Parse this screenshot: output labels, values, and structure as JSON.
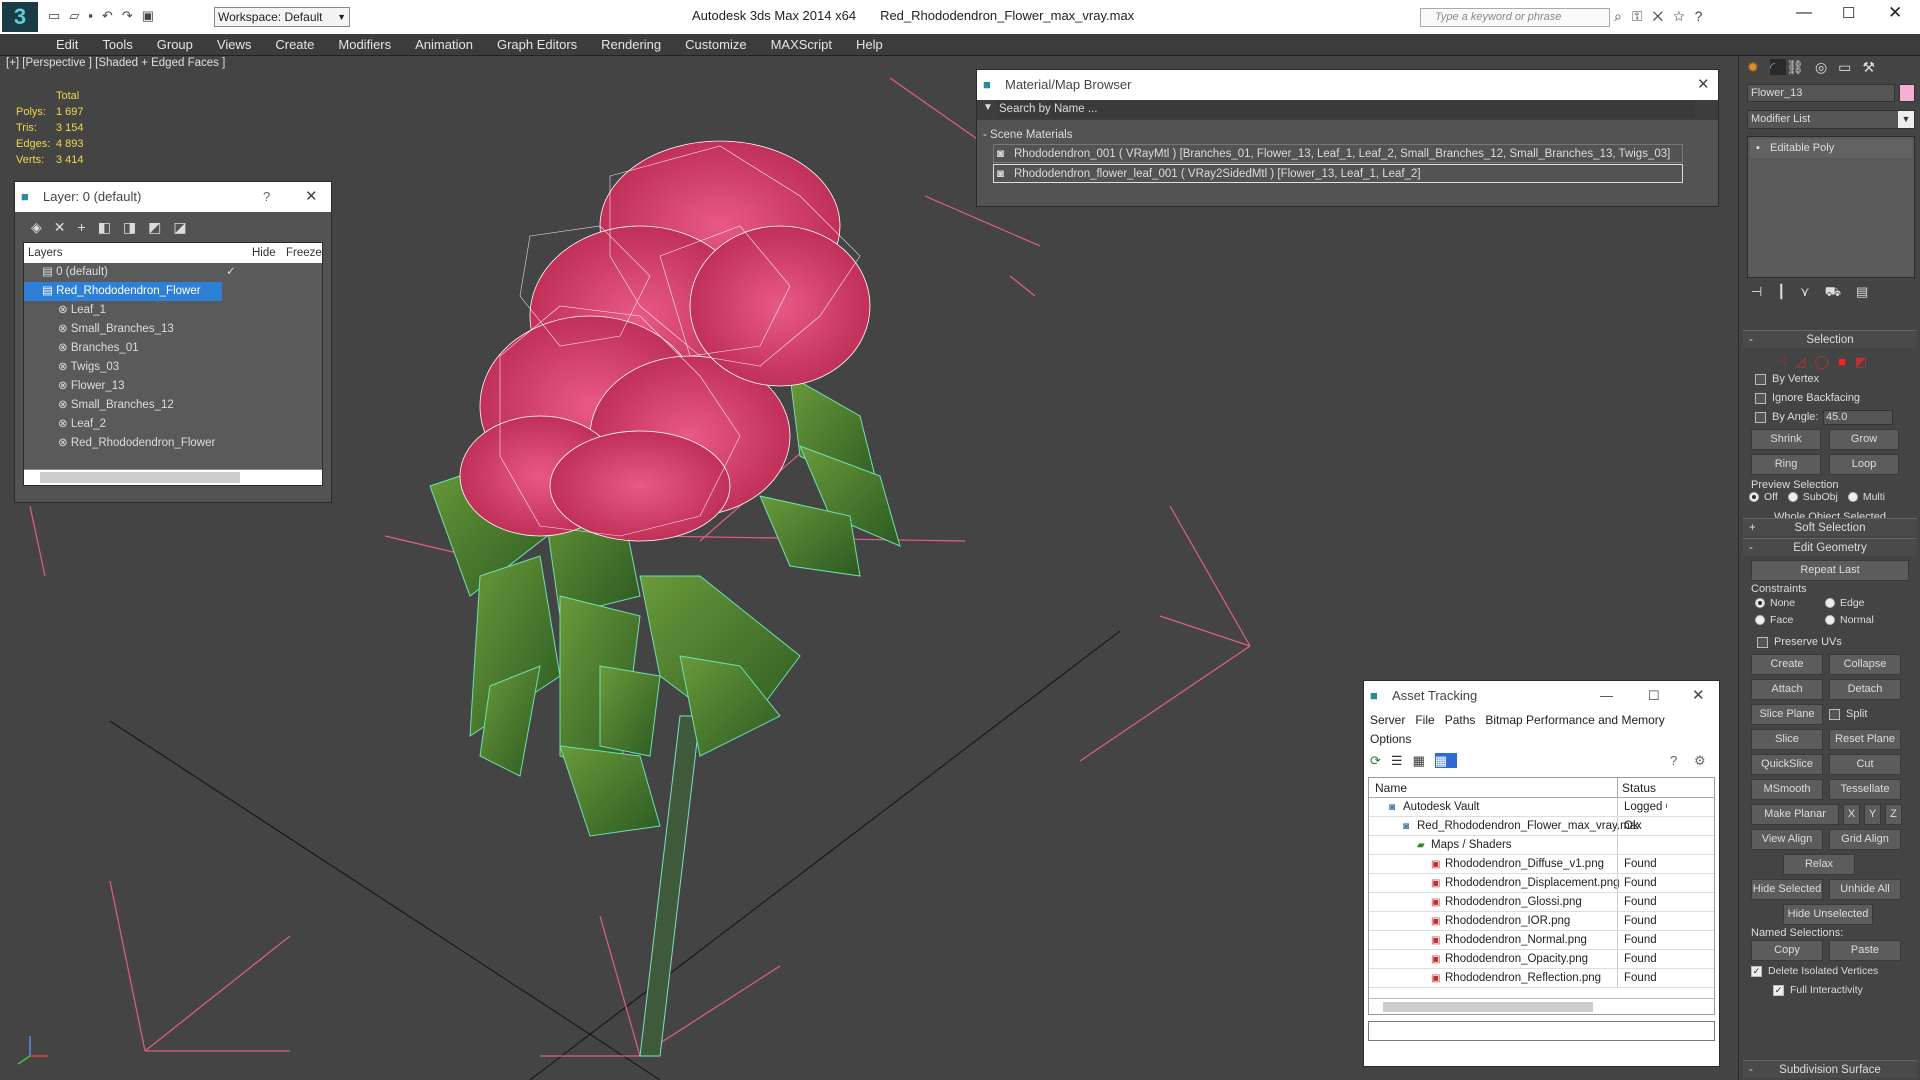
{
  "title": {
    "app": "Autodesk 3ds Max  2014 x64",
    "file": "Red_Rhododendron_Flower_max_vray.max",
    "workspace": "Workspace: Default",
    "search_placeholder": "Type a keyword or phrase"
  },
  "menu": [
    "Edit",
    "Tools",
    "Group",
    "Views",
    "Create",
    "Modifiers",
    "Animation",
    "Graph Editors",
    "Rendering",
    "Customize",
    "MAXScript",
    "Help"
  ],
  "viewport": {
    "label": "[+] [Perspective ] [Shaded + Edged Faces ]",
    "stats": {
      "header": "Total",
      "rows": [
        {
          "k": "Polys:",
          "v": "1 697"
        },
        {
          "k": "Tris:",
          "v": "3 154"
        },
        {
          "k": "Edges:",
          "v": "4 893"
        },
        {
          "k": "Verts:",
          "v": "3 414"
        }
      ]
    }
  },
  "layer": {
    "title": "Layer: 0 (default)",
    "help": "?",
    "cols": {
      "name": "Layers",
      "hide": "Hide",
      "freeze": "Freeze"
    },
    "rows": [
      "0 (default)",
      "Red_Rhododendron_Flower",
      "Leaf_1",
      "Small_Branches_13",
      "Branches_01",
      "Twigs_03",
      "Flower_13",
      "Small_Branches_12",
      "Leaf_2",
      "Red_Rhododendron_Flower"
    ]
  },
  "material": {
    "title": "Material/Map Browser",
    "search": "Search by Name ...",
    "section": "- Scene Materials",
    "items": [
      "Rhododendron_001  ( VRayMtl )  [Branches_01, Flower_13, Leaf_1, Leaf_2, Small_Branches_12, Small_Branches_13, Twigs_03]",
      "Rhododendron_flower_leaf_001  ( VRay2SidedMtl )  [Flower_13, Leaf_1, Leaf_2]"
    ]
  },
  "asset": {
    "title": "Asset Tracking",
    "menu": [
      "Server",
      "File",
      "Paths",
      "Bitmap Performance and Memory"
    ],
    "menu2": "Options",
    "cols": {
      "name": "Name",
      "status": "Status"
    },
    "rows": [
      {
        "n": "Autodesk Vault",
        "s": "Logged C",
        "ind": 0
      },
      {
        "n": "Red_Rhododendron_Flower_max_vray.max",
        "s": "Ok",
        "ind": 1
      },
      {
        "n": "Maps / Shaders",
        "s": "",
        "ind": 2
      },
      {
        "n": "Rhododendron_Diffuse_v1.png",
        "s": "Found",
        "ind": 3
      },
      {
        "n": "Rhododendron_Displacement.png",
        "s": "Found",
        "ind": 3
      },
      {
        "n": "Rhododendron_Glossi.png",
        "s": "Found",
        "ind": 3
      },
      {
        "n": "Rhododendron_IOR.png",
        "s": "Found",
        "ind": 3
      },
      {
        "n": "Rhododendron_Normal.png",
        "s": "Found",
        "ind": 3
      },
      {
        "n": "Rhododendron_Opacity.png",
        "s": "Found",
        "ind": 3
      },
      {
        "n": "Rhododendron_Reflection.png",
        "s": "Found",
        "ind": 3
      }
    ]
  },
  "cmd": {
    "object": "Flower_13",
    "modlist": "Modifier List",
    "stack": "Editable Poly",
    "selection": {
      "title": "Selection",
      "by_vertex": "By Vertex",
      "ignore_backfacing": "Ignore Backfacing",
      "by_angle": "By Angle:",
      "angle": "45.0",
      "shrink": "Shrink",
      "grow": "Grow",
      "ring": "Ring",
      "loop": "Loop",
      "preview": "Preview Selection",
      "off": "Off",
      "subobj": "SubObj",
      "multi": "Multi",
      "status": "Whole Object Selected"
    },
    "soft": "Soft Selection",
    "editgeo": "Edit Geometry",
    "repeat": "Repeat Last",
    "constraints": "Constraints",
    "none": "None",
    "edge": "Edge",
    "face": "Face",
    "normal": "Normal",
    "preserve": "Preserve UVs",
    "create": "Create",
    "collapse": "Collapse",
    "attach": "Attach",
    "detach": "Detach",
    "slice_plane": "Slice Plane",
    "split": "Split",
    "slice": "Slice",
    "reset_plane": "Reset Plane",
    "quickslice": "QuickSlice",
    "cut": "Cut",
    "msmooth": "MSmooth",
    "tessellate": "Tessellate",
    "make_planar": "Make Planar",
    "x": "X",
    "y": "Y",
    "z": "Z",
    "view_align": "View Align",
    "grid_align": "Grid Align",
    "relax": "Relax",
    "hide_sel": "Hide Selected",
    "unhide": "Unhide All",
    "hide_unsel": "Hide Unselected",
    "named": "Named Selections:",
    "copy": "Copy",
    "paste": "Paste",
    "delete_iso": "Delete Isolated Vertices",
    "full_inter": "Full Interactivity",
    "subdiv": "Subdivision Surface"
  }
}
